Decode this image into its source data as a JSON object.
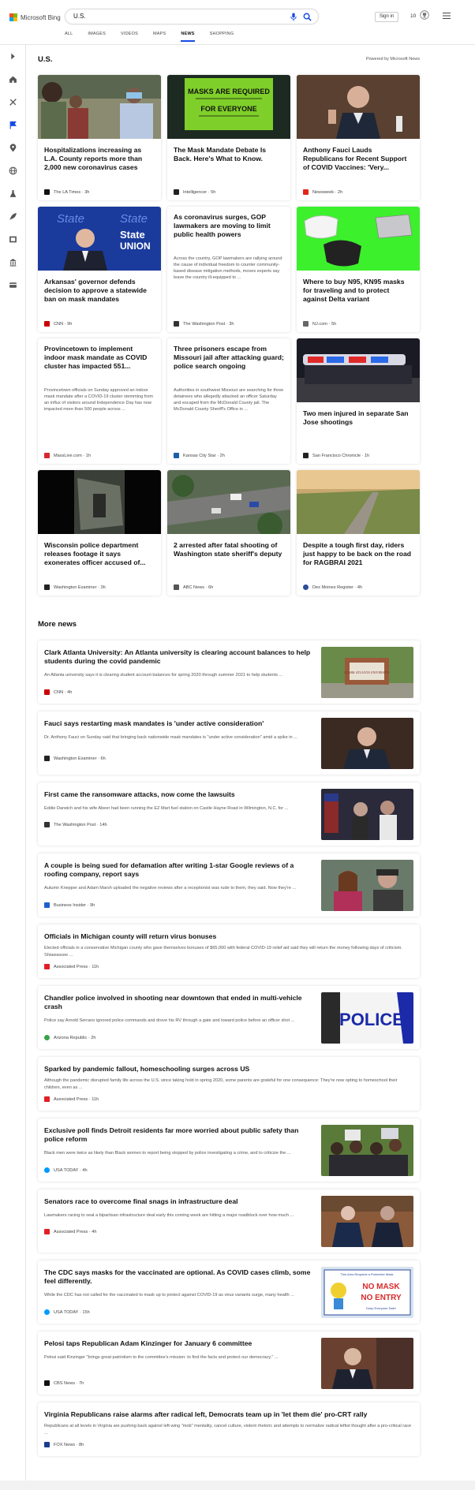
{
  "header": {
    "logo_text": "Microsoft Bing",
    "search_value": "U.S.",
    "signin_label": "Sign in",
    "rewards_count": "10"
  },
  "nav": {
    "tabs": [
      "ALL",
      "IMAGES",
      "VIDEOS",
      "MAPS",
      "NEWS",
      "SHOPPING"
    ],
    "active": "NEWS"
  },
  "section": {
    "title": "U.S.",
    "powered_by": "Powered by Microsoft News"
  },
  "cards": [
    {
      "title": "Hospitalizations increasing as L.A. County reports more than 2,000 new coronavirus cases",
      "source": "The LA Times",
      "age": "3h",
      "logo_color": "#111111"
    },
    {
      "title": "The Mask Mandate Debate Is Back. Here's What to Know.",
      "source": "Intelligencer",
      "age": "5h",
      "logo_color": "#222222"
    },
    {
      "title": "Anthony Fauci Lauds Republicans for Recent Support of COVID Vaccines: 'Very...",
      "source": "Newsweek",
      "age": "2h",
      "logo_color": "#e1251b"
    },
    {
      "title": "Arkansas' governor defends decision to approve a statewide ban on mask mandates",
      "source": "CNN",
      "age": "9h",
      "logo_color": "#cc0000"
    },
    {
      "title": "As coronavirus surges, GOP lawmakers are moving to limit public health powers",
      "snippet": "Across the country, GOP lawmakers are rallying around the cause of individual freedom to counter community-based disease mitigation methods, moves experts say leave the country ill-equipped to ...",
      "source": "The Washington Post",
      "age": "3h",
      "logo_color": "#333333"
    },
    {
      "title": "Where to buy N95, KN95 masks for traveling and to protect against Delta variant",
      "source": "NJ.com",
      "age": "5h",
      "logo_color": "#666666"
    },
    {
      "title": "Provincetown to implement indoor mask mandate as COVID cluster has impacted 551...",
      "snippet": "Provincetown officials on Sunday approved an indoor mask mandate after a COVID-19 cluster stemming from an influx of visitors around Independence Day has now impacted more than 500 people across ...",
      "source": "MassLive.com",
      "age": "1h",
      "logo_color": "#d7282f"
    },
    {
      "title": "Three prisoners escape from Missouri jail after attacking guard; police search ongoing",
      "snippet": "Authorities in southwest Missouri are searching for three detainees who allegedly attacked an officer Saturday and escaped from the McDonald County jail. The McDonald County Sheriff's Office in ...",
      "source": "Kansas City Star",
      "age": "2h",
      "logo_color": "#1a5fa8"
    },
    {
      "title": "Two men injured in separate San Jose shootings",
      "source": "San Francisco Chronicle",
      "age": "1h",
      "logo_color": "#222222"
    },
    {
      "title": "Wisconsin police department releases footage it says exonerates officer accused of...",
      "source": "Washington Examiner",
      "age": "3h",
      "logo_color": "#222222"
    },
    {
      "title": "2 arrested after fatal shooting of Washington state sheriff's deputy",
      "source": "ABC News",
      "age": "6h",
      "logo_color": "#555555"
    },
    {
      "title": "Despite a tough first day, riders just happy to be back on the road for RAGBRAI 2021",
      "source": "Des Moines Register",
      "age": "4h",
      "logo_color": "#2b4d9c"
    }
  ],
  "more_news": {
    "title": "More news",
    "items": [
      {
        "title": "Clark Atlanta University: An Atlanta university is clearing account balances to help students during the covid pandemic",
        "snippet": "An Atlanta university says it is clearing student account balances for spring 2020 through summer 2021 to help students ...",
        "source": "CNN",
        "age": "4h",
        "logo_color": "#cc0000"
      },
      {
        "title": "Fauci says restarting mask mandates is 'under active consideration'",
        "snippet": "Dr. Anthony Fauci on Sunday said that bringing back nationwide mask mandates is \"under active consideration\" amid a spike in ...",
        "source": "Washington Examiner",
        "age": "6h",
        "logo_color": "#222222"
      },
      {
        "title": "First came the ransomware attacks, now come the lawsuits",
        "snippet": "Eddie Darwich and his wife Abeer had been running the EZ Mart fuel station on Castle Hayne Road in Wilmington, N.C. for ...",
        "source": "The Washington Post",
        "age": "14h",
        "logo_color": "#333333"
      },
      {
        "title": "A couple is being sued for defamation after writing 1-star Google reviews of a roofing company, report says",
        "snippet": "Autumn Knepper and Adam Marsh uploaded the negative reviews after a receptionist was rude to them, they said. Now they're ...",
        "source": "Business Insider",
        "age": "9h",
        "logo_color": "#1f5fd0"
      },
      {
        "title": "Officials in Michigan county will return virus bonuses",
        "snippet": "Elected officials in a conservative Michigan county who gave themselves bonuses of $65,000 with federal COVID-19 relief aid said they will return the money following days of criticism. Shiawassee ...",
        "source": "Associated Press",
        "age": "11h",
        "logo_color": "#e21f26"
      },
      {
        "title": "Chandler police involved in shooting near downtown that ended in multi-vehicle crash",
        "snippet": "Police say Arnold Serrano ignored police commands and drove his RV through a gate and toward police before an officer shot ...",
        "source": "Arizona Republic",
        "age": "2h",
        "logo_color": "#3aa34a"
      },
      {
        "title": "Sparked by pandemic fallout, homeschooling surges across US",
        "snippet": "Although the pandemic disrupted family life across the U.S. since taking hold in spring 2020, some parents are grateful for one consequence: They're now opting to homeschool their children, even as ...",
        "source": "Associated Press",
        "age": "11h",
        "logo_color": "#e21f26"
      },
      {
        "title": "Exclusive poll finds Detroit residents far more worried about public safety than police reform",
        "snippet": "Black men were twice as likely than Black women to report being stopped by police investigating a crime, and to criticize the ...",
        "source": "USA TODAY",
        "age": "4h",
        "logo_color": "#009bff"
      },
      {
        "title": "Senators race to overcome final snags in infrastructure deal",
        "snippet": "Lawmakers racing to seal a bipartisan infrastructure deal early this coming week are hitting a major roadblock over how much ...",
        "source": "Associated Press",
        "age": "4h",
        "logo_color": "#e21f26"
      },
      {
        "title": "The CDC says masks for the vaccinated are optional. As COVID cases climb, some feel differently.",
        "snippet": "While the CDC has not called for the vaccinated to mask up to protect against COVID-19 as virus variants surge, many health ...",
        "source": "USA TODAY",
        "age": "15h",
        "logo_color": "#009bff"
      },
      {
        "title": "Pelosi taps Republican Adam Kinzinger for January 6 committee",
        "snippet": "Pelosi said Kinzinger \"brings great patriotism to the committee's mission: to find the facts and protect our democracy.\" ...",
        "source": "CBS News",
        "age": "7h",
        "logo_color": "#111111"
      },
      {
        "title": "Virginia Republicans raise alarms after radical left, Democrats team up in 'let them die' pro-CRT rally",
        "snippet": "Republicans at all levels in Virginia are pushing back against left-wing \"mob\" mentality, cancel culture, violent rhetoric and attempts to normalize radical leftist thought after a pro-critical race ...",
        "source": "FOX News",
        "age": "8h",
        "logo_color": "#1a3b8f"
      }
    ]
  },
  "image_texts": {
    "mask_sign_line1": "MASKS ARE REQUIRED",
    "mask_sign_line2": "FOR EVERYONE",
    "sotu_1": "State",
    "sotu_2": "UNION",
    "school_sign": "CLARK ATLANTA UNIVERSITY",
    "police_text": "POLICE",
    "cdc_sign_top": "This Area Requires a Protective Mask",
    "cdc_sign_1": "NO MASK",
    "cdc_sign_2": "NO ENTRY",
    "cdc_sign_3": "Keep Everyone Safe!"
  },
  "icons": [
    "expand-icon",
    "home-icon",
    "tools-icon",
    "flag-icon",
    "location-icon",
    "globe-icon",
    "science-icon",
    "rocket-icon",
    "film-icon",
    "bank-icon",
    "card-icon"
  ]
}
